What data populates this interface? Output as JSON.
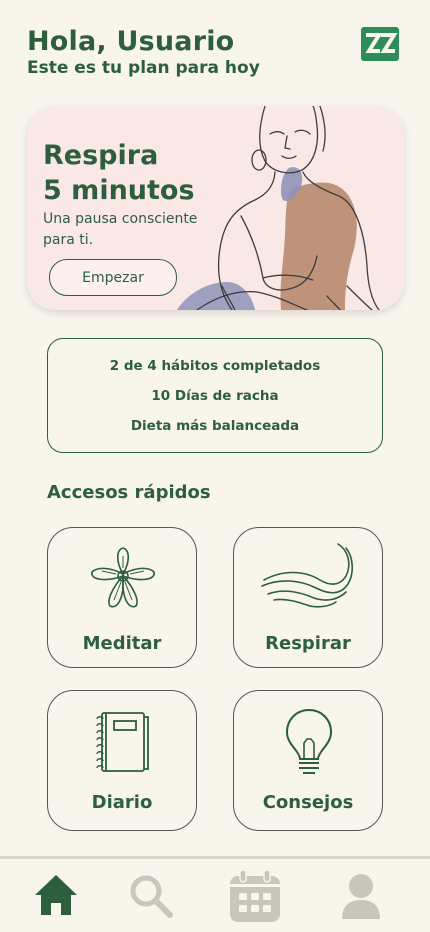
{
  "header": {
    "greeting": "Hola, Usuario",
    "subtitle": "Este es tu plan para hoy",
    "logo_icon": "zz-logo-icon"
  },
  "hero": {
    "title_line1": "Respira",
    "title_line2": "5 minutos",
    "description": "Una pausa consciente para ti.",
    "button_label": "Empezar"
  },
  "stats": {
    "habits": "2 de 4 hábitos completados",
    "streak": "10 Días de racha",
    "diet": "Dieta más balanceada"
  },
  "quick_access": {
    "title": "Accesos rápidos",
    "items": [
      {
        "label": "Meditar",
        "icon": "flower-icon"
      },
      {
        "label": "Respirar",
        "icon": "wind-icon"
      },
      {
        "label": "Diario",
        "icon": "notebook-icon"
      },
      {
        "label": "Consejos",
        "icon": "lightbulb-icon"
      }
    ]
  },
  "nav": {
    "items": [
      {
        "icon": "home-icon",
        "active": true
      },
      {
        "icon": "search-icon",
        "active": false
      },
      {
        "icon": "calendar-icon",
        "active": false
      },
      {
        "icon": "profile-icon",
        "active": false
      }
    ]
  },
  "colors": {
    "primary": "#2d5f3e",
    "background": "#f8f5ec",
    "hero_bg": "#f9e8e6",
    "inactive_nav": "#c8c6bd"
  }
}
